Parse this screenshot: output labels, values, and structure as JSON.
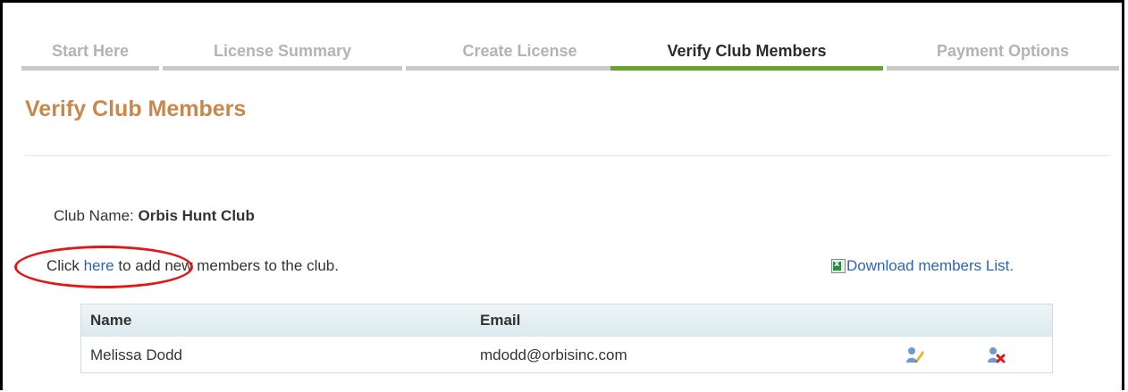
{
  "wizard": {
    "steps": [
      {
        "label": "Start Here",
        "active": false
      },
      {
        "label": "License Summary",
        "active": false
      },
      {
        "label": "Create License",
        "active": false
      },
      {
        "label": "Verify Club Members",
        "active": true
      },
      {
        "label": "Payment Options",
        "active": false
      }
    ]
  },
  "page": {
    "title": "Verify Club Members"
  },
  "club": {
    "label": "Club Name:",
    "name": "Orbis Hunt Club"
  },
  "add_members": {
    "prefix": "Click",
    "link": "here",
    "suffix": "to add new members to the club."
  },
  "download": {
    "icon": "excel-file-icon",
    "label": "Download members List."
  },
  "members_table": {
    "columns": [
      "Name",
      "Email"
    ],
    "rows": [
      {
        "name": "Melissa Dodd",
        "email": "mdodd@orbisinc.com",
        "actions": [
          "edit-user-icon",
          "delete-user-icon"
        ]
      }
    ]
  },
  "colors": {
    "title": "#c9874b",
    "active_step_bar": "#6aa32c",
    "inactive_step_bar": "#c9c9c9",
    "link": "#2f63b5",
    "annotation_ring": "#e01818"
  }
}
